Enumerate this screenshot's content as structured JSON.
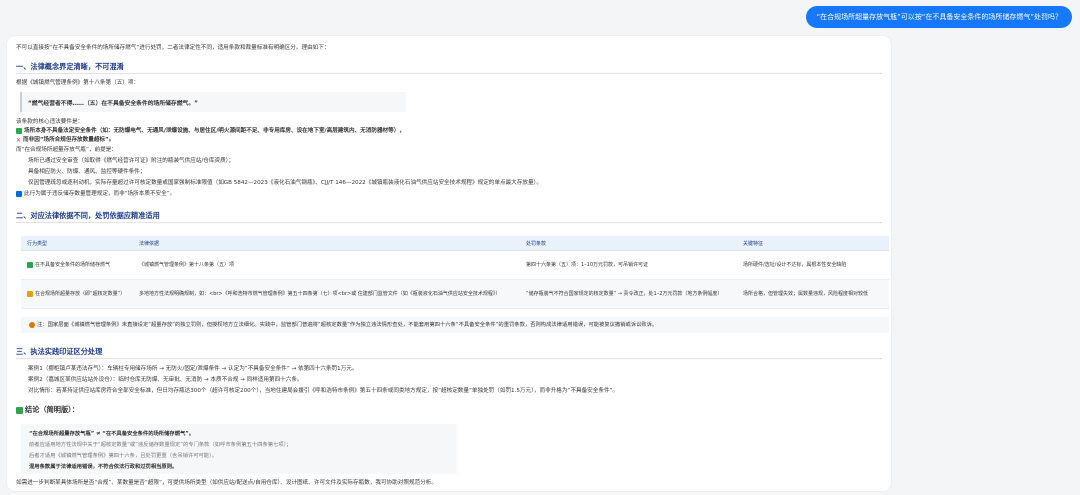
{
  "user_message": "“在合规场所超量存放气瓶”可以按“在不具备安全条件的场所储存燃气”处罚吗？",
  "intro": "不可以直接按“在不具备安全条件的场所储存燃气”进行处罚，二者法律定性不同，适用条款和裁量标准有明确区分。理由如下：",
  "s1": {
    "title": "一、法律概念界定清晰，不可混淆",
    "basis": "根据《城镇燃气管理条例》第十八条第（五）项：",
    "quote": "“燃气经营者不得……（五）在不具备安全条件的场所储存燃气。”",
    "core_label": "该条款的核心违法要件是：",
    "core1": "场所本身不具备法定安全条件（如：无防爆电气、无通风/泄爆设施、与居住区/明火源间距不足、非专用库房、设在地下室/高层建筑内、无消防器材等），",
    "core2": "而非因“场所合规但存放数量超标”。",
    "contrast": "而“在合规场所超量存放气瓶”，前提是：",
    "p1": "场所已通过安全审查（如取得《燃气经营许可证》附注的瓶装气供应站/仓库资质）；",
    "p2": "具备相应防火、防爆、通风、监控等硬件条件；",
    "p3": "仅因管理疏忽或逐利动机，实际存量超过许可核定数量或国家强制标准限值（如GB 5842—2023《液化石油气钢瓶》、CJJ/T 146—2022《城镇瓶装液化石油气供应站安全技术规程》规定的单点最大存放量）。",
    "conclusion": "此行为属于违反储存数量管理规定，而非“场所本质不安全”。"
  },
  "s2": {
    "title": "二、对应法律依据不同，处罚依据应精准适用",
    "headers": [
      "行为类型",
      "法律依据",
      "处罚条款",
      "关键特征"
    ],
    "rows": [
      [
        "在不具备安全条件的场所储存燃气",
        "《城镇燃气管理条例》第十八条第（五）项",
        "第四十六条第（五）项：1–10万元罚款，可吊销许可证",
        "场所硬件/选址/设计不达标，属根本性安全缺陷"
      ],
      [
        "在合规场所超量存放（即“超核定数量”）",
        "多地地方性法规明确规制，如：<br>《呼和浩特市燃气管理条例》第五十四条第（七）项<br>或 住建部门监管文件（如《瓶装液化石油气供应站安全技术规程》）",
        "“储存瓶装气不符合国家规定的核定数量” → 责令改正，处1–2万元罚款（地方条例幅度）",
        "场所合格，但管理失效；属数量违规，风险程度相对较低"
      ]
    ],
    "note": "注：国家层面《城镇燃气管理条例》未直接设定“超量存放”的独立罚则，但授权地方立法细化。实践中，监管部门普遍将“超核定数量”作为独立违法情形查处，不能套用第四十六条“不具备安全条件”的重罚条款，否则构成法律适用错误，可能被复议撤销或诉讼败诉。"
  },
  "s3": {
    "title": "三、执法实践印证区分处理",
    "c1": "案例1（挪柜镇卢某违法存气）：车辆柱专用储存场所 → 无防火/固定/泄爆条件 → 认定为“不具备安全条件” → 依第四十六条罚1万元。",
    "c2": "案例2（嘉城区某供应站站外设仓）：临时仓库无防爆、无审批、无消防 → 本质不合规 → 同样适用第四十六条。",
    "c3": "对比情形：若某持证供应站库房符合全部安全标准，但日均存瓶达300个（超许可核定200个），当地住建局会援引《呼和浩特市条例》第五十四条或同类地方规定，按“超核定数量”单独处罚（如罚1.5万元），而非升格为“不具备安全条件”。"
  },
  "summary": {
    "title": "结论（简明版）：",
    "l1": "“在合规场所超量存放气瓶” ≠ “在不具备安全条件的场所储存燃气”。",
    "l2": "前者应适用地方性法规中关于“超核定数量”或“违反储存数量规定”的专门条款（如呼市条例第五十四条第七项）；",
    "l3": "后者才适用《城镇燃气管理条例》第四十六条，且处罚更重（含吊销许可可能）。",
    "l4": "混用条款属于法律适用错误，不符合依法行政和过罚相当原则。"
  },
  "followup": "如需进一步判断某具体场所是否“合规”、某数量是否“超限”，可提供场所类型（如供应站/配送点/自用仓库）、设计图纸、许可文件及实际存瓶数，我可协助对照规范分析。",
  "icons": {
    "check": "check-icon",
    "cross": "cross-icon",
    "info": "info-icon",
    "pin": "pin-icon"
  },
  "colors": {
    "accent": "#1677ff",
    "heading": "#1f3c88",
    "table_header": "#e9f1fb"
  }
}
